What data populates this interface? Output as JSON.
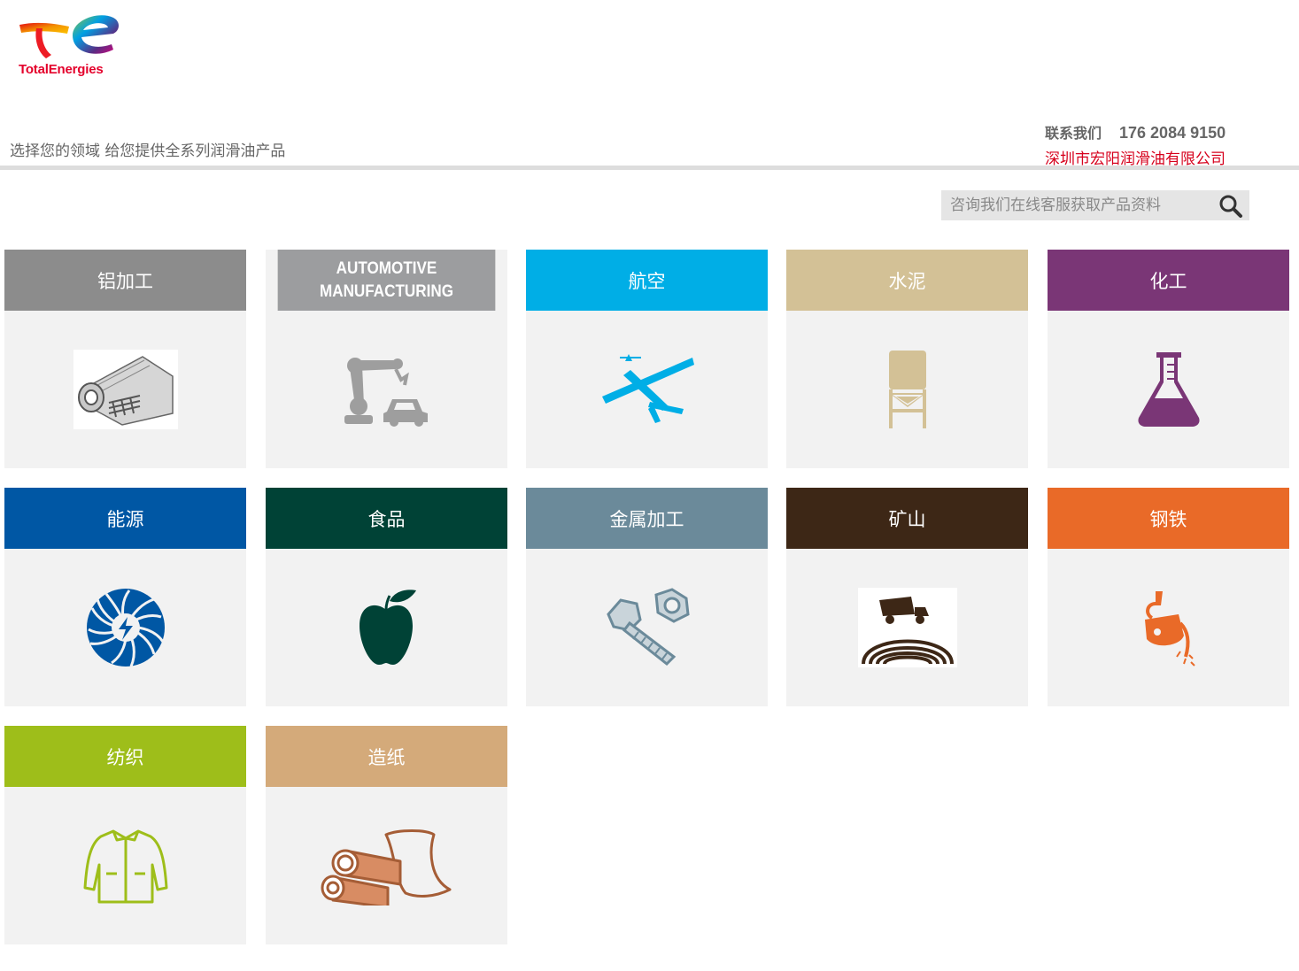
{
  "brand": {
    "name": "TotalEnergies",
    "accent": "#e4002b"
  },
  "header": {
    "tagline": "选择您的领域 给您提供全系列润滑油产品",
    "contact_label": "联系我们",
    "phone": "176 2084 9150",
    "company": "深圳市宏阳润滑油有限公司"
  },
  "search": {
    "placeholder": "咨询我们在线客服获取产品资料",
    "icon": "search-icon"
  },
  "tiles": [
    {
      "label": "铝加工",
      "color": "#8c8c8c",
      "icon": "aluminium-roll-icon"
    },
    {
      "label": "AUTOMOTIVE MANUFACTURING",
      "color": "#9c9d9f",
      "icon": "robot-arm-car-icon"
    },
    {
      "label": "航空",
      "color": "#00aee6",
      "icon": "airplane-icon"
    },
    {
      "label": "水泥",
      "color": "#d3c196",
      "icon": "cement-silo-icon"
    },
    {
      "label": "化工",
      "color": "#7a3676",
      "icon": "flask-icon"
    },
    {
      "label": "能源",
      "color": "#0057a4",
      "icon": "turbine-icon"
    },
    {
      "label": "食品",
      "color": "#004236",
      "icon": "apple-icon"
    },
    {
      "label": "金属加工",
      "color": "#6b8a9a",
      "icon": "bolt-nut-icon"
    },
    {
      "label": "矿山",
      "color": "#3d2716",
      "icon": "mining-truck-icon"
    },
    {
      "label": "钢铁",
      "color": "#e96a28",
      "icon": "ladle-icon"
    },
    {
      "label": "纺织",
      "color": "#9ebe1a",
      "icon": "jacket-icon"
    },
    {
      "label": "造纸",
      "color": "#d4aa7a",
      "icon": "logs-paper-icon"
    }
  ]
}
